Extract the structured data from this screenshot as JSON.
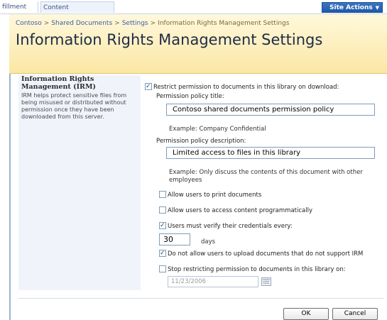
{
  "nav": {
    "tab_partial": "fillment",
    "tab_content_dev": "Content Development",
    "site_actions": "Site Actions"
  },
  "breadcrumb": {
    "site": "Contoso",
    "library": "Shared Documents",
    "settings": "Settings",
    "current": "Information Rights Management Settings",
    "separator": ">"
  },
  "page_title": "Information Rights Management Settings",
  "description": {
    "title": "Information Rights Management (IRM)",
    "text": "IRM helps protect sensitive files from being misused or distributed without permission once they have been downloaded from this server."
  },
  "form": {
    "restrict": {
      "label": "Restrict permission to documents in this library on download:",
      "checked": true
    },
    "policy_title_label": "Permission policy title:",
    "policy_title_value": "Contoso shared documents permission policy",
    "policy_title_example": "Example: Company Confidential",
    "policy_desc_label": "Permission policy description:",
    "policy_desc_value": "Limited access to files in this library",
    "policy_desc_example": "Example: Only discuss the contents of this document with other employees",
    "allow_print": {
      "label": "Allow users to print documents",
      "checked": false
    },
    "allow_programmatic": {
      "label": "Allow users to access content programmatically",
      "checked": false
    },
    "verify_credentials": {
      "label": "Users must verify their credentials every:",
      "checked": true
    },
    "verify_days_value": "30",
    "verify_days_unit": "days",
    "no_upload_unsupported": {
      "label": "Do not allow users to upload documents that do not support IRM",
      "checked": true
    },
    "stop_restricting": {
      "label": "Stop restricting permission to documents in this library on:",
      "checked": false
    },
    "stop_date_value": "11/23/2006"
  },
  "buttons": {
    "ok": "OK",
    "cancel": "Cancel"
  },
  "icons": {
    "site_actions_arrow": "chevron-down-icon",
    "date_picker": "calendar-icon"
  },
  "colors": {
    "title_band": "#fbe7a4",
    "link": "#3b5da5",
    "site_actions": "#1f5aa8",
    "desc_pane": "#f0f4fa"
  }
}
